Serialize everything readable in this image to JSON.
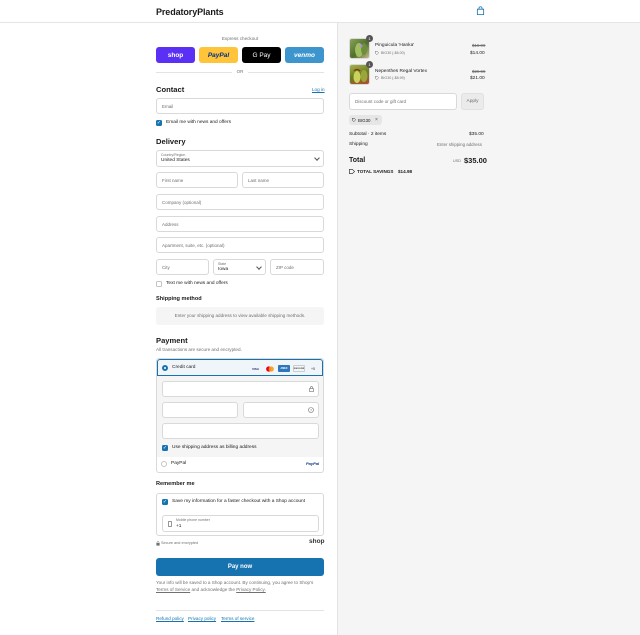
{
  "header": {
    "brand": "PredatoryPlants",
    "cart_icon": "shopping-bag-icon"
  },
  "express": {
    "title": "Express checkout",
    "buttons": [
      {
        "label": "shop",
        "bg": "#5a31f4",
        "color": "#ffffff"
      },
      {
        "label": "PayPal",
        "bg": "#ffc439",
        "color": "#003087"
      },
      {
        "label": "G Pay",
        "bg": "#000000",
        "color": "#ffffff"
      },
      {
        "label": "venmo",
        "bg": "#3d95ce",
        "color": "#ffffff"
      }
    ],
    "or": "OR"
  },
  "contact": {
    "heading": "Contact",
    "login": "Log in",
    "email_placeholder": "Email",
    "newsletter_label": "Email me with news and offers"
  },
  "delivery": {
    "heading": "Delivery",
    "country_label": "Country/Region",
    "country_value": "United States",
    "first_name": "First name",
    "last_name": "Last name",
    "company": "Company (optional)",
    "address": "Address",
    "apartment": "Apartment, suite, etc. (optional)",
    "city": "City",
    "state_label": "State",
    "state_value": "Iowa",
    "zip": "ZIP code",
    "text_label": "Text me with news and offers"
  },
  "shipping": {
    "heading": "Shipping method",
    "message": "Enter your shipping address to view available shipping methods."
  },
  "payment": {
    "heading": "Payment",
    "subtitle": "All transactions are secure and encrypted.",
    "credit_card_label": "Credit card",
    "card_logos": [
      "VISA",
      "MC",
      "AMEX",
      "DISCOVER",
      "+5"
    ],
    "billing_label": "Use shipping address as billing address",
    "paypal_label": "PayPal",
    "paypal_logo": "PayPal"
  },
  "remember": {
    "heading": "Remember me",
    "save_label": "Save my information for a faster checkout with a Shop account",
    "phone_label": "Mobile phone number",
    "phone_value": "+1",
    "secure_text": "Secure and encrypted",
    "shop_logo": "shop"
  },
  "pay_now": "Pay now",
  "legal": {
    "text": "Your info will be saved to a Shop account. By continuing, you agree to Shop's",
    "terms": "Terms of Service",
    "and": "and acknowledge the",
    "privacy": "Privacy Policy."
  },
  "footer": {
    "links": [
      "Refund policy",
      "Privacy policy",
      "Terms of service"
    ]
  },
  "cart": {
    "items": [
      {
        "name": "Pinguicula 'Hanka'",
        "qty": "1",
        "discount": "BIG30 (-$6.00)",
        "old_price": "$19.99",
        "price": "$14.00"
      },
      {
        "name": "Nepenthes Regal Vortex",
        "qty": "1",
        "discount": "BIG30 (-$8.99)",
        "old_price": "$29.99",
        "price": "$21.00"
      }
    ],
    "discount_placeholder": "Discount code or gift card",
    "apply": "Apply",
    "applied_code": "BIG30",
    "subtotal_label": "Subtotal · 2 items",
    "subtotal": "$35.00",
    "shipping_label": "Shipping",
    "shipping_value": "Enter shipping address",
    "total_label": "Total",
    "currency": "USD",
    "total": "$35.00",
    "savings_label": "TOTAL SAVINGS",
    "savings": "$14.98"
  }
}
